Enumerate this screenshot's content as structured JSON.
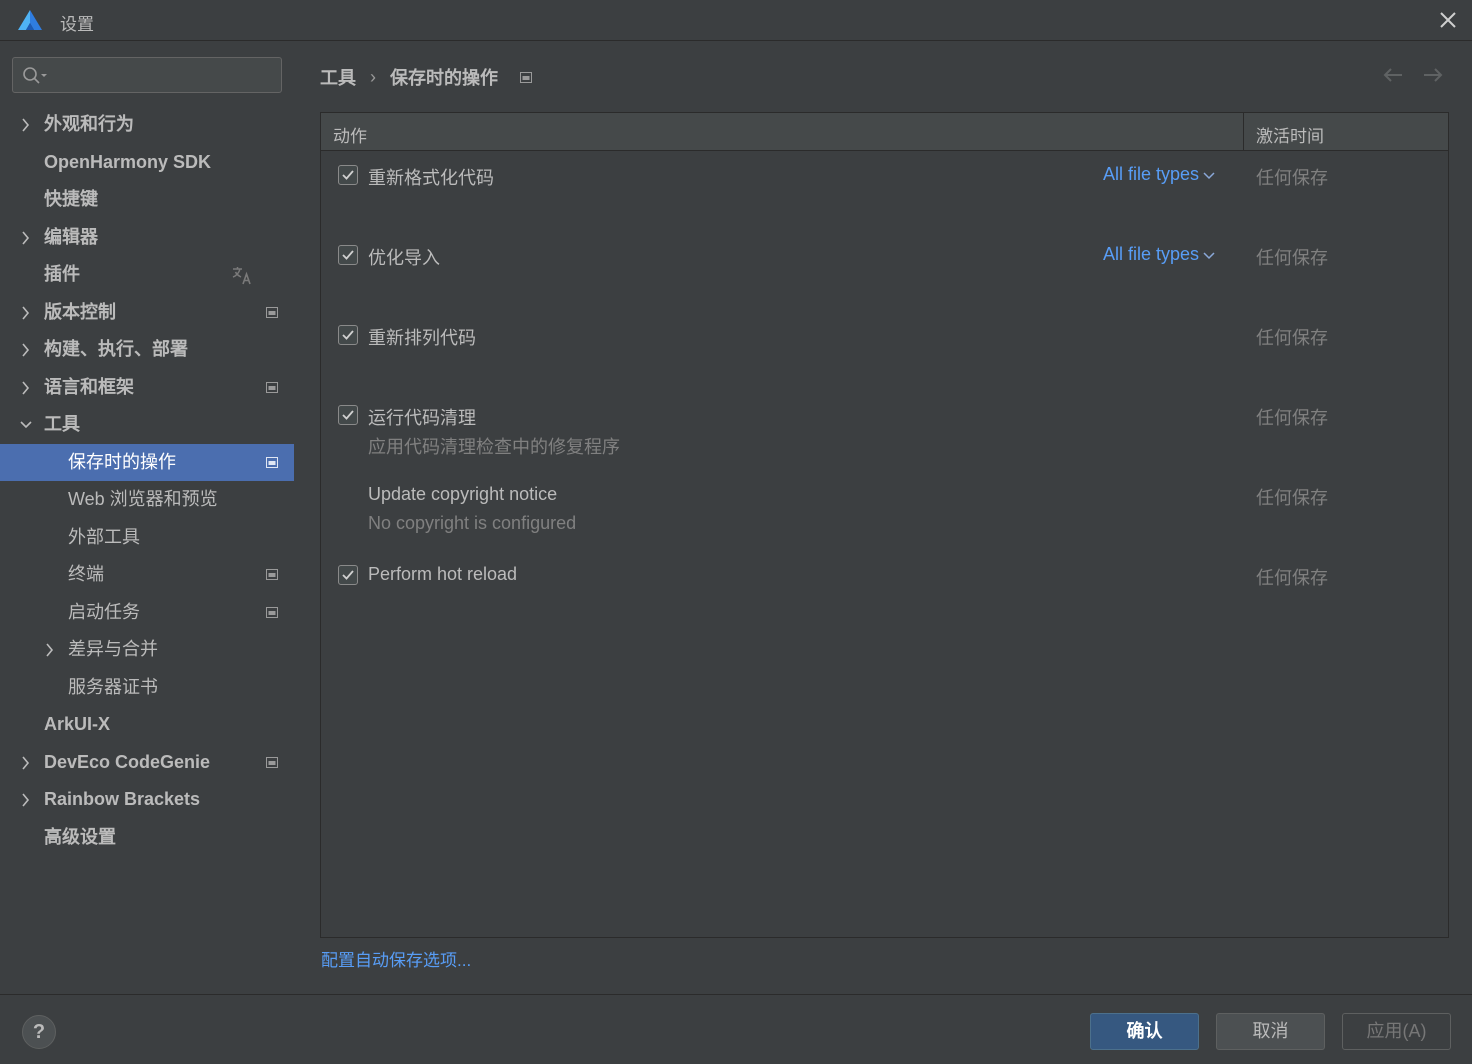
{
  "window": {
    "title": "设置",
    "logo_icon": "deveco-logo-icon",
    "close_icon": "close-icon"
  },
  "search": {
    "value": "",
    "placeholder": ""
  },
  "sidebar": {
    "items": [
      {
        "label": "外观和行为",
        "expandable": true,
        "expanded": false
      },
      {
        "label": "OpenHarmony SDK",
        "expandable": false
      },
      {
        "label": "快捷键",
        "expandable": false
      },
      {
        "label": "编辑器",
        "expandable": true,
        "expanded": false
      },
      {
        "label": "插件",
        "expandable": false,
        "icon": "translate-icon"
      },
      {
        "label": "版本控制",
        "expandable": true,
        "expanded": false,
        "icon": "project-icon"
      },
      {
        "label": "构建、执行、部署",
        "expandable": true,
        "expanded": false
      },
      {
        "label": "语言和框架",
        "expandable": true,
        "expanded": false,
        "icon": "project-icon"
      },
      {
        "label": "工具",
        "expandable": true,
        "expanded": true
      },
      {
        "label": "保存时的操作",
        "child": true,
        "selected": true,
        "icon": "project-icon"
      },
      {
        "label": "Web 浏览器和预览",
        "child": true
      },
      {
        "label": "外部工具",
        "child": true
      },
      {
        "label": "终端",
        "child": true,
        "icon": "project-icon"
      },
      {
        "label": "启动任务",
        "child": true,
        "icon": "project-icon"
      },
      {
        "label": "差异与合并",
        "child": true,
        "expandable": true,
        "expanded": false
      },
      {
        "label": "服务器证书",
        "child": true
      },
      {
        "label": "ArkUI-X",
        "expandable": false
      },
      {
        "label": "DevEco CodeGenie",
        "expandable": true,
        "expanded": false,
        "icon": "project-icon"
      },
      {
        "label": "Rainbow Brackets",
        "expandable": true,
        "expanded": false
      },
      {
        "label": "高级设置",
        "expandable": false
      }
    ]
  },
  "breadcrumb": {
    "parent": "工具",
    "separator": "›",
    "current": "保存时的操作"
  },
  "table": {
    "col_action": "动作",
    "col_activate": "激活时间",
    "rows": [
      {
        "checked": true,
        "title": "重新格式化代码",
        "subtitle": "",
        "file_types": "All file types",
        "activate": "任何保存"
      },
      {
        "checked": true,
        "title": "优化导入",
        "subtitle": "",
        "file_types": "All file types",
        "activate": "任何保存"
      },
      {
        "checked": true,
        "title": "重新排列代码",
        "subtitle": "",
        "file_types": "",
        "activate": "任何保存"
      },
      {
        "checked": true,
        "title": "运行代码清理",
        "subtitle": "应用代码清理检查中的修复程序",
        "file_types": "",
        "activate": "任何保存"
      },
      {
        "checked": null,
        "title": "Update copyright notice",
        "subtitle": "No copyright is configured",
        "file_types": "",
        "activate": "任何保存"
      },
      {
        "checked": true,
        "title": "Perform hot reload",
        "subtitle": "",
        "file_types": "",
        "activate": "任何保存"
      }
    ]
  },
  "autosave_link": "配置自动保存选项...",
  "footer": {
    "help": "?",
    "ok": "确认",
    "cancel": "取消",
    "apply": "应用(A)"
  },
  "colors": {
    "background": "#3c3f41",
    "selection": "#4b6eaf",
    "link": "#589df6",
    "primary_button": "#365880"
  }
}
